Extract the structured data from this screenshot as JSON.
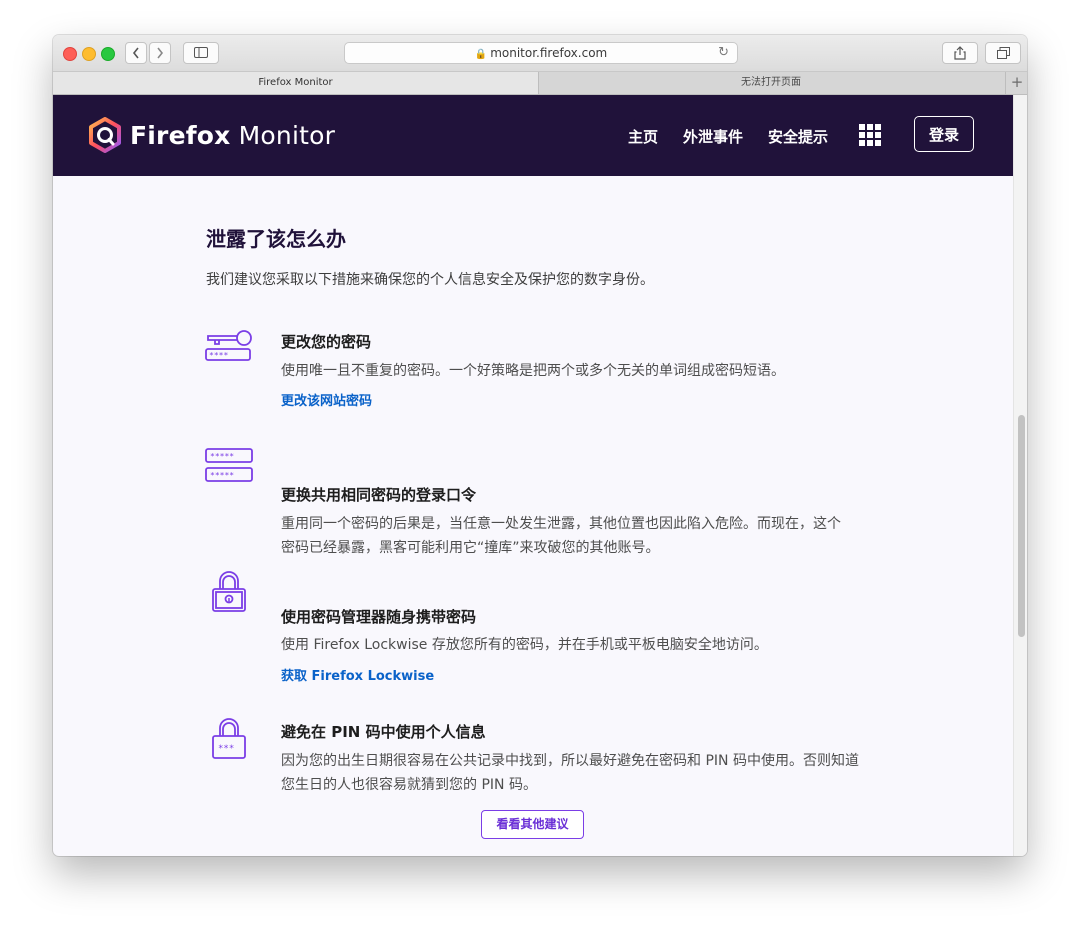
{
  "browser": {
    "url": "monitor.firefox.com",
    "tabs": [
      {
        "label": "Firefox Monitor"
      },
      {
        "label": "无法打开页面"
      }
    ],
    "add_tab": "+"
  },
  "header": {
    "logo_bold": "Firefox",
    "logo_light": " Monitor",
    "nav": [
      {
        "label": "主页"
      },
      {
        "label": "外泄事件"
      },
      {
        "label": "安全提示"
      }
    ],
    "login_label": "登录"
  },
  "main": {
    "title": "泄露了该怎么办",
    "intro": "我们建议您采取以下措施来确保您的个人信息安全及保护您的数字身份。",
    "tips": [
      {
        "icon": "key-password-icon",
        "title": "更改您的密码",
        "desc": "使用唯一且不重复的密码。一个好策略是把两个或多个无关的单词组成密码短语。",
        "link": "更改该网站密码"
      },
      {
        "icon": "password-fields-icon",
        "title": "更换共用相同密码的登录口令",
        "desc": "重用同一个密码的后果是，当任意一处发生泄露，其他位置也因此陷入危险。而现在，这个密码已经暴露，黑客可能利用它“撞库”来攻破您的其他账号。"
      },
      {
        "icon": "lock-key-icon",
        "title": "使用密码管理器随身携带密码",
        "desc": "使用 Firefox Lockwise 存放您所有的密码，并在手机或平板电脑安全地访问。",
        "link": "获取 Firefox Lockwise"
      },
      {
        "icon": "lock-pin-icon",
        "title": "避免在 PIN 码中使用个人信息",
        "desc": "因为您的出生日期很容易在公共记录中找到，所以最好避免在密码和 PIN 码中使用。否则知道您生日的人也很容易就猜到您的 PIN 码。"
      }
    ],
    "more_button": "看看其他建议"
  },
  "colors": {
    "header_bg": "#20123a",
    "link": "#0a62c9",
    "icon_purple": "#7b3ee6",
    "button_purple": "#6a2fd6"
  }
}
